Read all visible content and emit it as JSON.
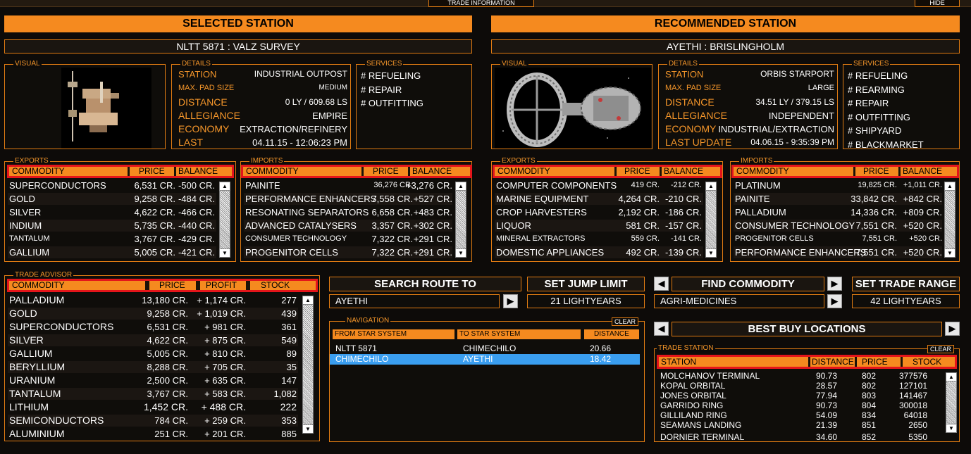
{
  "top": {
    "trade_info": "TRADE INFORMATION",
    "hide": "HIDE"
  },
  "selected": {
    "title": "SELECTED STATION",
    "name": "NLTT 5871 : VALZ SURVEY",
    "visual_label": "VISUAL",
    "details_label": "DETAILS",
    "services_label": "SERVICES",
    "details": [
      {
        "label": "STATION",
        "value": "INDUSTRIAL OUTPOST"
      },
      {
        "label": "MAX. PAD SIZE",
        "value": "MEDIUM"
      },
      {
        "label": "DISTANCE",
        "value": "0 LY / 609.68 LS"
      },
      {
        "label": "ALLEGIANCE",
        "value": "EMPIRE"
      },
      {
        "label": "ECONOMY",
        "value": "EXTRACTION/REFINERY"
      },
      {
        "label": "LAST",
        "value": "04.11.15 - 12:06:23 PM"
      }
    ],
    "services": [
      "# REFUELING",
      "# REPAIR",
      "# OUTFITTING"
    ],
    "exports": {
      "label": "EXPORTS",
      "headers": [
        "COMMODITY",
        "PRICE",
        "BALANCE"
      ],
      "rows": [
        [
          "SUPERCONDUCTORS",
          "6,531 CR.",
          "-500 CR."
        ],
        [
          "GOLD",
          "9,258 CR.",
          "-484 CR."
        ],
        [
          "SILVER",
          "4,622 CR.",
          "-466 CR."
        ],
        [
          "INDIUM",
          "5,735 CR.",
          "-440 CR."
        ],
        [
          "TANTALUM",
          "3,767 CR.",
          "-429 CR."
        ],
        [
          "GALLIUM",
          "5,005 CR.",
          "-421 CR."
        ]
      ]
    },
    "imports": {
      "label": "IMPORTS",
      "headers": [
        "COMMODITY",
        "PRICE",
        "BALANCE"
      ],
      "rows": [
        [
          "PAINITE",
          "36,276 CR.",
          "+3,276 CR."
        ],
        [
          "PERFORMANCE ENHANCERS",
          "7,558 CR.",
          "+527 CR."
        ],
        [
          "RESONATING SEPARATORS",
          "6,658 CR.",
          "+483 CR."
        ],
        [
          "ADVANCED CATALYSERS",
          "3,357 CR.",
          "+302 CR."
        ],
        [
          "CONSUMER TECHNOLOGY",
          "7,322 CR.",
          "+291 CR."
        ],
        [
          "PROGENITOR CELLS",
          "7,322 CR.",
          "+291 CR."
        ]
      ]
    }
  },
  "recommended": {
    "title": "RECOMMENDED STATION",
    "name": "AYETHI : BRISLINGHOLM",
    "visual_label": "VISUAL",
    "details_label": "DETAILS",
    "services_label": "SERVICES",
    "details": [
      {
        "label": "STATION",
        "value": "ORBIS STARPORT"
      },
      {
        "label": "MAX. PAD SIZE",
        "value": "LARGE"
      },
      {
        "label": "DISTANCE",
        "value": "34.51 LY / 379.15 LS"
      },
      {
        "label": "ALLEGIANCE",
        "value": "INDEPENDENT"
      },
      {
        "label": "ECONOMY",
        "value": "INDUSTRIAL/EXTRACTION"
      },
      {
        "label": "LAST UPDATE",
        "value": "04.06.15 - 9:35:39 PM"
      }
    ],
    "services": [
      "# REFUELING",
      "# REARMING",
      "# REPAIR",
      "# OUTFITTING",
      "# SHIPYARD",
      "# BLACKMARKET"
    ],
    "exports": {
      "label": "EXPORTS",
      "headers": [
        "COMMODITY",
        "PRICE",
        "BALANCE"
      ],
      "rows": [
        [
          "COMPUTER COMPONENTS",
          "419 CR.",
          "-212 CR."
        ],
        [
          "MARINE EQUIPMENT",
          "4,264 CR.",
          "-210 CR."
        ],
        [
          "CROP HARVESTERS",
          "2,192 CR.",
          "-186 CR."
        ],
        [
          "LIQUOR",
          "581 CR.",
          "-157 CR."
        ],
        [
          "MINERAL EXTRACTORS",
          "559 CR.",
          "-141 CR."
        ],
        [
          "DOMESTIC APPLIANCES",
          "492 CR.",
          "-139 CR."
        ]
      ]
    },
    "imports": {
      "label": "IMPORTS",
      "headers": [
        "COMMODITY",
        "PRICE",
        "BALANCE"
      ],
      "rows": [
        [
          "PLATINUM",
          "19,825 CR.",
          "+1,011 CR."
        ],
        [
          "PAINITE",
          "33,842 CR.",
          "+842 CR."
        ],
        [
          "PALLADIUM",
          "14,336 CR.",
          "+809 CR."
        ],
        [
          "CONSUMER TECHNOLOGY",
          "7,551 CR.",
          "+520 CR."
        ],
        [
          "PROGENITOR CELLS",
          "7,551 CR.",
          "+520 CR."
        ],
        [
          "PERFORMANCE ENHANCERS",
          "7,551 CR.",
          "+520 CR."
        ]
      ]
    }
  },
  "trade_advisor": {
    "label": "TRADE ADVISOR",
    "headers": [
      "COMMODITY",
      "PRICE",
      "PROFIT",
      "STOCK"
    ],
    "rows": [
      [
        "PALLADIUM",
        "13,180 CR.",
        "+ 1,174 CR.",
        "277"
      ],
      [
        "GOLD",
        "9,258 CR.",
        "+ 1,019 CR.",
        "439"
      ],
      [
        "SUPERCONDUCTORS",
        "6,531 CR.",
        "+ 981 CR.",
        "361"
      ],
      [
        "SILVER",
        "4,622 CR.",
        "+ 875 CR.",
        "549"
      ],
      [
        "GALLIUM",
        "5,005 CR.",
        "+ 810 CR.",
        "89"
      ],
      [
        "BERYLLIUM",
        "8,288 CR.",
        "+ 705 CR.",
        "35"
      ],
      [
        "URANIUM",
        "2,500 CR.",
        "+ 635 CR.",
        "147"
      ],
      [
        "TANTALUM",
        "3,767 CR.",
        "+ 583 CR.",
        "1,082"
      ],
      [
        "LITHIUM",
        "1,452 CR.",
        "+ 488 CR.",
        "222"
      ],
      [
        "SEMICONDUCTORS",
        "784 CR.",
        "+ 259 CR.",
        "353"
      ],
      [
        "ALUMINIUM",
        "251 CR.",
        "+ 201 CR.",
        "885"
      ]
    ]
  },
  "route": {
    "search_label": "SEARCH ROUTE TO",
    "search_value": "AYETHI",
    "jump_label": "SET JUMP LIMIT",
    "jump_value": "21 LIGHTYEARS",
    "find_label": "FIND COMMODITY",
    "find_value": "AGRI-MEDICINES",
    "range_label": "SET TRADE RANGE",
    "range_value": "42 LIGHTYEARS"
  },
  "navigation": {
    "label": "NAVIGATION",
    "clear": "CLEAR",
    "headers": [
      "FROM STAR SYSTEM",
      "TO STAR SYSTEM",
      "DISTANCE"
    ],
    "rows": [
      [
        "NLTT 5871",
        "CHIMECHILO",
        "20.66"
      ],
      [
        "CHIMECHILO",
        "AYETHI",
        "18.42"
      ]
    ]
  },
  "best_buy": {
    "title": "BEST BUY LOCATIONS",
    "label": "TRADE STATION",
    "clear": "CLEAR",
    "headers": [
      "STATION",
      "DISTANCE",
      "PRICE",
      "STOCK"
    ],
    "rows": [
      [
        "MOLCHANOV TERMINAL",
        "90.73",
        "802",
        "377576"
      ],
      [
        "KOPAL ORBITAL",
        "28.57",
        "802",
        "127101"
      ],
      [
        "JONES ORBITAL",
        "77.94",
        "803",
        "141467"
      ],
      [
        "GARRIDO RING",
        "90.73",
        "804",
        "300018"
      ],
      [
        "GILLILAND RING",
        "54.09",
        "834",
        "64018"
      ],
      [
        "SEAMANS LANDING",
        "21.39",
        "851",
        "2650"
      ],
      [
        "DORNIER TERMINAL",
        "34.60",
        "852",
        "5350"
      ]
    ]
  },
  "colors": {
    "accent": "#f58a1f",
    "header_outline": "#e4151a",
    "selection": "#3a9ef0"
  },
  "icons": {
    "left_arrow": "left-arrow-icon",
    "right_arrow": "right-arrow-icon",
    "scroll_up": "scroll-up-icon",
    "scroll_down": "scroll-down-icon"
  }
}
